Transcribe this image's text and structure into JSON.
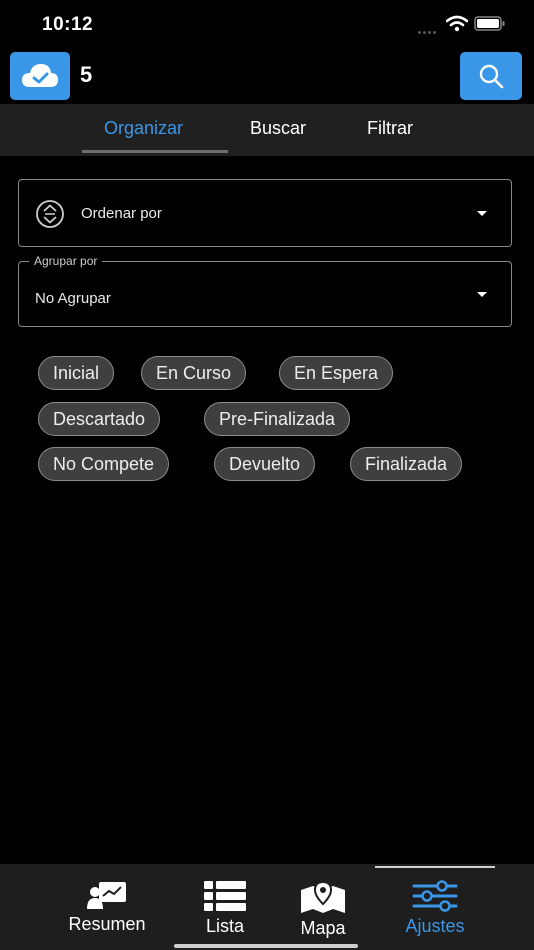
{
  "status_bar": {
    "time": "10:12"
  },
  "header": {
    "count": "5",
    "cloud_icon": "cloud-check-icon",
    "search_icon": "search-icon"
  },
  "tabs": [
    {
      "label": "Organizar",
      "active": true
    },
    {
      "label": "Buscar",
      "active": false
    },
    {
      "label": "Filtrar",
      "active": false
    }
  ],
  "sort": {
    "placeholder": "Ordenar por"
  },
  "group": {
    "legend": "Agrupar por",
    "value": "No Agrupar"
  },
  "chips": [
    "Inicial",
    "En Curso",
    "En Espera",
    "Descartado",
    "Pre-Finalizada",
    "No Compete",
    "Devuelto",
    "Finalizada"
  ],
  "nav": [
    {
      "label": "Resumen",
      "icon": "summary-icon",
      "active": false
    },
    {
      "label": "Lista",
      "icon": "list-icon",
      "active": false
    },
    {
      "label": "Mapa",
      "icon": "map-icon",
      "active": false
    },
    {
      "label": "Ajustes",
      "icon": "settings-sliders-icon",
      "active": true
    }
  ],
  "colors": {
    "accent": "#3a97e8",
    "background": "#000000",
    "tab_bar": "#202020",
    "chip_bg": "#3f3f3f"
  }
}
